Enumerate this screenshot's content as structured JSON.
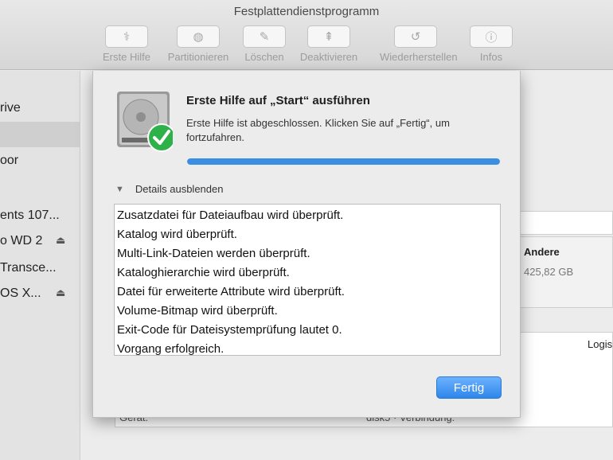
{
  "window": {
    "title": "Festplattendienstprogramm"
  },
  "toolbar": [
    {
      "label": "Erste Hilfe",
      "icon": "first-aid-icon",
      "glyph": "⚕"
    },
    {
      "label": "Partitionieren",
      "icon": "partition-icon",
      "glyph": "◍"
    },
    {
      "label": "Löschen",
      "icon": "erase-icon",
      "glyph": "✎"
    },
    {
      "label": "Deaktivieren",
      "icon": "unmount-icon",
      "glyph": "⇞"
    },
    {
      "label": "Wiederherstellen",
      "icon": "restore-icon",
      "glyph": "↺"
    },
    {
      "label": "Infos",
      "icon": "info-icon",
      "glyph": "ⓘ"
    }
  ],
  "sidebar": {
    "items": [
      {
        "label": "rive",
        "eject": ""
      },
      {
        "label": "",
        "eject": ""
      },
      {
        "label": "oor",
        "eject": ""
      },
      {
        "label": "ents 107...",
        "eject": ""
      },
      {
        "label": "o WD 2",
        "eject": "⏏"
      },
      {
        "label": "Transce...",
        "eject": ""
      },
      {
        "label": "OS X...",
        "eject": "⏏"
      }
    ]
  },
  "background": {
    "andere_label": "Andere",
    "andere_size": "425,82 GB",
    "logis": "Logis",
    "geraet": "Gerät:",
    "verbindung": "disk5 · Verbindung:"
  },
  "dialog": {
    "title": "Erste Hilfe auf „Start“ ausführen",
    "message": "Erste Hilfe ist abgeschlossen. Klicken Sie auf „Fertig“, um fortzufahren.",
    "progress": 1.0,
    "details_toggle": "Details ausblenden",
    "log_lines": [
      "Zusatzdatei für Dateiaufbau wird überprüft.",
      "Katalog wird überprüft.",
      "Multi-Link-Dateien werden überprüft.",
      "Kataloghierarchie wird überprüft.",
      "Datei für erweiterte Attribute wird überprüft.",
      "Volume-Bitmap wird überprüft.",
      "Exit-Code für Dateisystemprüfung lautet 0.",
      "Vorgang erfolgreich."
    ],
    "done_label": "Fertig"
  },
  "colors": {
    "accent": "#3b8fe3",
    "check_green": "#2fb14a"
  }
}
